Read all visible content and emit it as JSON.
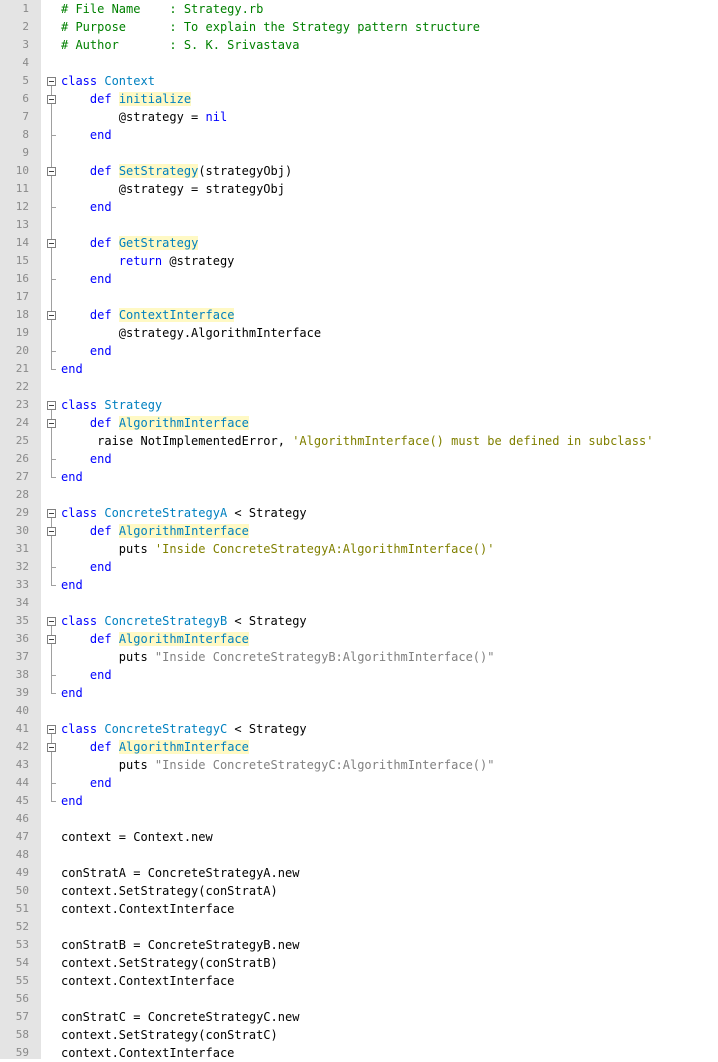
{
  "lines": [
    [
      {
        "t": "# File Name    : Strategy.rb",
        "c": "cm"
      }
    ],
    [
      {
        "t": "# Purpose      : To explain the Strategy pattern structure",
        "c": "cm"
      }
    ],
    [
      {
        "t": "# Author       : S. K. Srivastava",
        "c": "cm"
      }
    ],
    [],
    [
      {
        "t": "class",
        "c": "kw"
      },
      {
        "t": " "
      },
      {
        "t": "Context",
        "c": "cls"
      }
    ],
    [
      {
        "t": "    "
      },
      {
        "t": "def",
        "c": "kw"
      },
      {
        "t": " "
      },
      {
        "t": "initialize",
        "c": "fn"
      }
    ],
    [
      {
        "t": "        @strategy = "
      },
      {
        "t": "nil",
        "c": "kw"
      }
    ],
    [
      {
        "t": "    "
      },
      {
        "t": "end",
        "c": "kw"
      }
    ],
    [],
    [
      {
        "t": "    "
      },
      {
        "t": "def",
        "c": "kw"
      },
      {
        "t": " "
      },
      {
        "t": "SetStrategy",
        "c": "fn"
      },
      {
        "t": "(strategyObj)"
      }
    ],
    [
      {
        "t": "        @strategy = strategyObj"
      }
    ],
    [
      {
        "t": "    "
      },
      {
        "t": "end",
        "c": "kw"
      }
    ],
    [],
    [
      {
        "t": "    "
      },
      {
        "t": "def",
        "c": "kw"
      },
      {
        "t": " "
      },
      {
        "t": "GetStrategy",
        "c": "fn"
      }
    ],
    [
      {
        "t": "        "
      },
      {
        "t": "return",
        "c": "kw"
      },
      {
        "t": " @strategy"
      }
    ],
    [
      {
        "t": "    "
      },
      {
        "t": "end",
        "c": "kw"
      }
    ],
    [],
    [
      {
        "t": "    "
      },
      {
        "t": "def",
        "c": "kw"
      },
      {
        "t": " "
      },
      {
        "t": "ContextInterface",
        "c": "fn"
      }
    ],
    [
      {
        "t": "        @strategy.AlgorithmInterface"
      }
    ],
    [
      {
        "t": "    "
      },
      {
        "t": "end",
        "c": "kw"
      }
    ],
    [
      {
        "t": "end",
        "c": "kw"
      }
    ],
    [],
    [
      {
        "t": "class",
        "c": "kw"
      },
      {
        "t": " "
      },
      {
        "t": "Strategy",
        "c": "cls"
      }
    ],
    [
      {
        "t": "    "
      },
      {
        "t": "def",
        "c": "kw"
      },
      {
        "t": " "
      },
      {
        "t": "AlgorithmInterface",
        "c": "fn"
      }
    ],
    [
      {
        "t": "     raise NotImplementedError, "
      },
      {
        "t": "'AlgorithmInterface() must be defined in subclass'",
        "c": "str"
      }
    ],
    [
      {
        "t": "    "
      },
      {
        "t": "end",
        "c": "kw"
      }
    ],
    [
      {
        "t": "end",
        "c": "kw"
      }
    ],
    [],
    [
      {
        "t": "class",
        "c": "kw"
      },
      {
        "t": " "
      },
      {
        "t": "ConcreteStrategyA",
        "c": "cls"
      },
      {
        "t": " < Strategy"
      }
    ],
    [
      {
        "t": "    "
      },
      {
        "t": "def",
        "c": "kw"
      },
      {
        "t": " "
      },
      {
        "t": "AlgorithmInterface",
        "c": "fn"
      }
    ],
    [
      {
        "t": "        puts "
      },
      {
        "t": "'Inside ConcreteStrategyA:AlgorithmInterface()'",
        "c": "str"
      }
    ],
    [
      {
        "t": "    "
      },
      {
        "t": "end",
        "c": "kw"
      }
    ],
    [
      {
        "t": "end",
        "c": "kw"
      }
    ],
    [],
    [
      {
        "t": "class",
        "c": "kw"
      },
      {
        "t": " "
      },
      {
        "t": "ConcreteStrategyB",
        "c": "cls"
      },
      {
        "t": " < Strategy"
      }
    ],
    [
      {
        "t": "    "
      },
      {
        "t": "def",
        "c": "kw"
      },
      {
        "t": " "
      },
      {
        "t": "AlgorithmInterface",
        "c": "fn"
      }
    ],
    [
      {
        "t": "        puts "
      },
      {
        "t": "\"Inside ConcreteStrategyB:AlgorithmInterface()\"",
        "c": "dstr"
      }
    ],
    [
      {
        "t": "    "
      },
      {
        "t": "end",
        "c": "kw"
      }
    ],
    [
      {
        "t": "end",
        "c": "kw"
      }
    ],
    [],
    [
      {
        "t": "class",
        "c": "kw"
      },
      {
        "t": " "
      },
      {
        "t": "ConcreteStrategyC",
        "c": "cls"
      },
      {
        "t": " < Strategy"
      }
    ],
    [
      {
        "t": "    "
      },
      {
        "t": "def",
        "c": "kw"
      },
      {
        "t": " "
      },
      {
        "t": "AlgorithmInterface",
        "c": "fn"
      }
    ],
    [
      {
        "t": "        puts "
      },
      {
        "t": "\"Inside ConcreteStrategyC:AlgorithmInterface()\"",
        "c": "dstr"
      }
    ],
    [
      {
        "t": "    "
      },
      {
        "t": "end",
        "c": "kw"
      }
    ],
    [
      {
        "t": "end",
        "c": "kw"
      }
    ],
    [],
    [
      {
        "t": "context = Context.new"
      }
    ],
    [],
    [
      {
        "t": "conStratA = ConcreteStrategyA.new"
      }
    ],
    [
      {
        "t": "context.SetStrategy(conStratA)"
      }
    ],
    [
      {
        "t": "context.ContextInterface"
      }
    ],
    [],
    [
      {
        "t": "conStratB = ConcreteStrategyB.new"
      }
    ],
    [
      {
        "t": "context.SetStrategy(conStratB)"
      }
    ],
    [
      {
        "t": "context.ContextInterface"
      }
    ],
    [],
    [
      {
        "t": "conStratC = ConcreteStrategyC.new"
      }
    ],
    [
      {
        "t": "context.SetStrategy(conStratC)"
      }
    ],
    [
      {
        "t": "context.ContextInterface"
      }
    ]
  ],
  "folds": [
    [
      5,
      21
    ],
    [
      6,
      8
    ],
    [
      10,
      12
    ],
    [
      14,
      16
    ],
    [
      18,
      20
    ],
    [
      23,
      27
    ],
    [
      24,
      26
    ],
    [
      29,
      33
    ],
    [
      30,
      32
    ],
    [
      35,
      39
    ],
    [
      36,
      38
    ],
    [
      41,
      45
    ],
    [
      42,
      44
    ]
  ],
  "colors": {
    "keyword": "#0000ff",
    "class_name": "#0080c0",
    "comment": "#008000",
    "single_string": "#808000",
    "double_string": "#808080",
    "gutter": "#e4e4e4"
  }
}
